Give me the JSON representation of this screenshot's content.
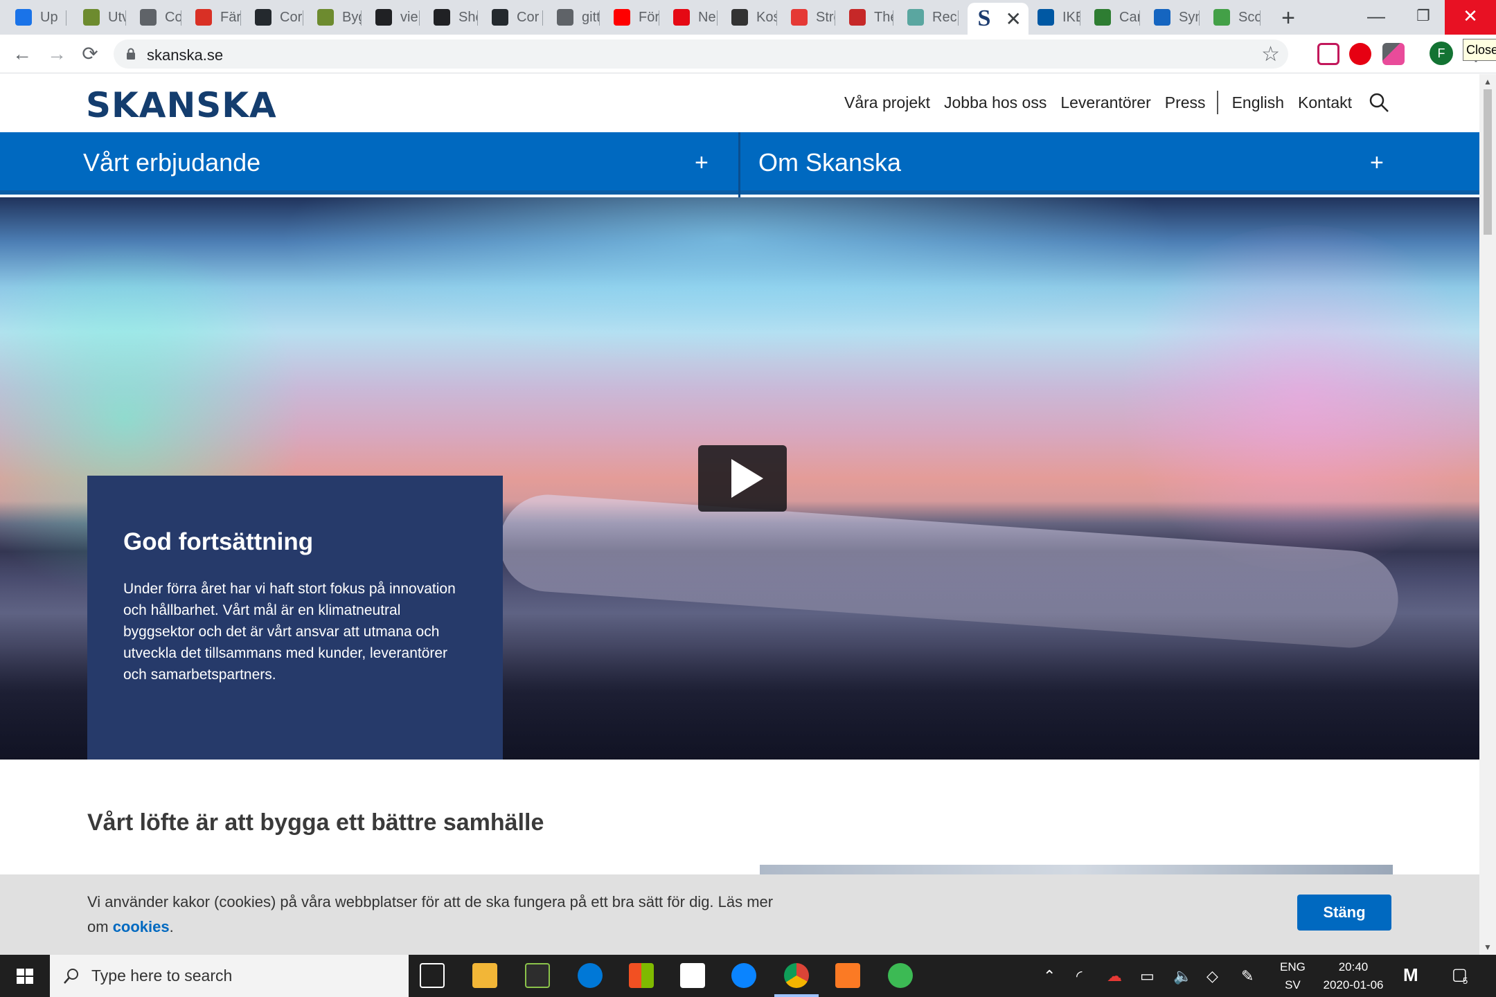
{
  "browser": {
    "tabs": [
      {
        "label": "Up",
        "color": "#1a73e8"
      },
      {
        "label": "Utv",
        "color": "#6d8b2f"
      },
      {
        "label": "Col",
        "color": "#5f6368"
      },
      {
        "label": "Fär",
        "color": "#d93025"
      },
      {
        "label": "Cor",
        "color": "#24292e"
      },
      {
        "label": "Byg",
        "color": "#6d8b2f"
      },
      {
        "label": "vie",
        "color": "#202124"
      },
      {
        "label": "Sho",
        "color": "#202124"
      },
      {
        "label": "Cor",
        "color": "#24292e"
      },
      {
        "label": "gitt",
        "color": "#5f6368"
      },
      {
        "label": "För",
        "color": "#ff0000"
      },
      {
        "label": "Ne",
        "color": "#e50914"
      },
      {
        "label": "Kos",
        "color": "#333333"
      },
      {
        "label": "Stre",
        "color": "#e53935"
      },
      {
        "label": "The",
        "color": "#c62828"
      },
      {
        "label": "Rec",
        "color": "#5aa6a0"
      },
      {
        "label": "S",
        "color": "#1b3b6f",
        "active": true
      },
      {
        "label": "IKE",
        "color": "#0058a3"
      },
      {
        "label": "Car",
        "color": "#2e7d32"
      },
      {
        "label": "Syn",
        "color": "#1565c0"
      },
      {
        "label": "Sco",
        "color": "#43a047"
      }
    ],
    "new_tab": "+",
    "close_tooltip": "Close",
    "url": "skanska.se",
    "profile_initial": "F",
    "icons": {
      "back": "←",
      "forward": "→",
      "reload": "⟳",
      "star": "☆",
      "kebab": "⋮"
    }
  },
  "site": {
    "logo": "SKANSKA",
    "nav": [
      "Våra projekt",
      "Jobba hos oss",
      "Leverantörer",
      "Press",
      "English",
      "Kontakt"
    ],
    "mega_menu": [
      {
        "label": "Vårt erbjudande",
        "icon": "+"
      },
      {
        "label": "Om Skanska",
        "icon": "+"
      }
    ],
    "hero": {
      "title": "God fortsättning",
      "body": "Under förra året har vi haft stort fokus på innovation och hållbarhet. Vårt mål är en klimatneutral byggsektor och det är vårt ansvar att utmana och utveckla det tillsammans med kunder, leverantörer och samarbetspartners."
    },
    "section_title": "Vårt löfte är att bygga ett bättre samhälle",
    "cookie": {
      "text": "Vi använder kakor (cookies) på våra webbplatser för att de ska fungera på ett bra sätt för dig. Läs mer om ",
      "link": "cookies",
      "after_link": ".",
      "button": "Stäng"
    },
    "colors": {
      "brand_navy": "#143d6e",
      "brand_blue": "#0069c0",
      "card": "#263a6a"
    }
  },
  "taskbar": {
    "search_placeholder": "Type here to search",
    "lang": "ENG",
    "lang_sub": "SV",
    "time": "20:40",
    "date": "2020-01-06",
    "notifications": "5"
  }
}
